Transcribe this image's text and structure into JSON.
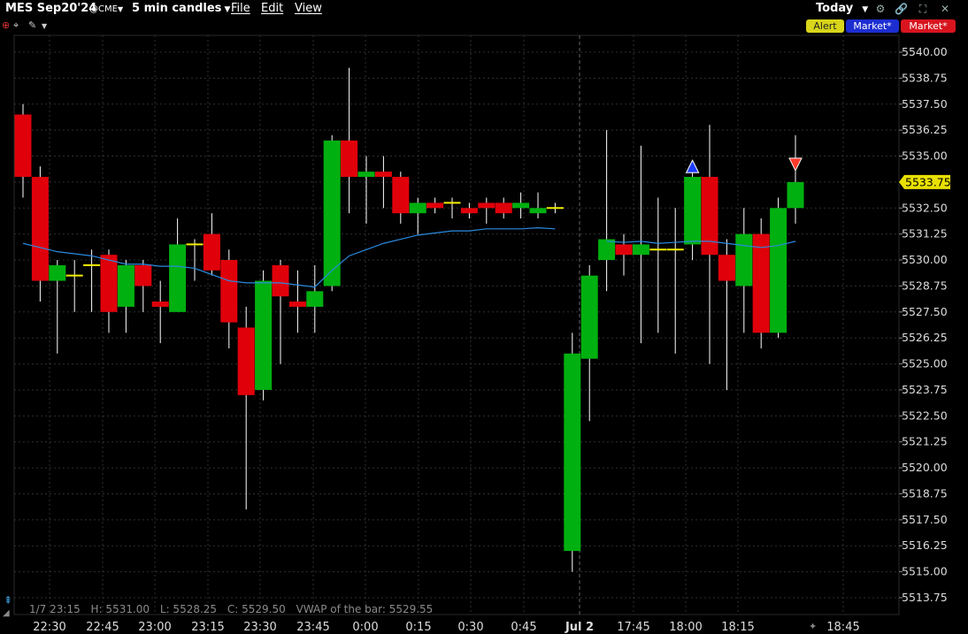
{
  "header": {
    "symbol": "MES Sep20'24",
    "exchange": "@CME",
    "timeframe": "5 min candles",
    "menu": [
      "File",
      "Edit",
      "View"
    ],
    "range": "Today",
    "icons": [
      "gear-icon",
      "link-icon",
      "expand-icon",
      "close-icon"
    ]
  },
  "order_buttons": {
    "alert": "Alert",
    "market_buy": "Market*",
    "market_sell": "Market*"
  },
  "colors": {
    "up": "#00b010",
    "down": "#e0000a",
    "vwap": "#2a8be0",
    "last_price_bg": "#e8e000"
  },
  "chart_data": {
    "type": "candlestick",
    "y_ticks": [
      "5540.00",
      "5538.75",
      "5537.50",
      "5536.25",
      "5535.00",
      "5533.75",
      "5532.50",
      "5531.25",
      "5530.00",
      "5528.75",
      "5527.50",
      "5526.25",
      "5525.00",
      "5523.75",
      "5522.50",
      "5521.25",
      "5520.00",
      "5518.75",
      "5517.50",
      "5516.25",
      "5515.00",
      "5513.75"
    ],
    "ylim": [
      5513.25,
      5540.25
    ],
    "x_ticks": [
      "22:30",
      "22:45",
      "23:00",
      "23:15",
      "23:30",
      "23:45",
      "0:00",
      "0:15",
      "0:30",
      "0:45",
      "Jul 2",
      "17:45",
      "18:00",
      "18:15",
      "18:45"
    ],
    "last_price": "5533.75",
    "bar_info": {
      "date_time": "1/7 23:15",
      "high": "H: 5531.00",
      "low": "L: 5528.25",
      "close": "C: 5529.50",
      "vwap": "VWAP of the bar: 5529.55"
    },
    "candles": [
      {
        "o": 5537.0,
        "h": 5537.5,
        "l": 5533.0,
        "c": 5534.0
      },
      {
        "o": 5534.0,
        "h": 5534.5,
        "l": 5528.0,
        "c": 5529.0
      },
      {
        "o": 5529.0,
        "h": 5530.0,
        "l": 5525.5,
        "c": 5529.75
      },
      {
        "o": 5529.25,
        "h": 5530.0,
        "l": 5527.5,
        "c": 5529.25
      },
      {
        "o": 5529.75,
        "h": 5530.5,
        "l": 5527.5,
        "c": 5529.75
      },
      {
        "o": 5530.25,
        "h": 5530.5,
        "l": 5526.5,
        "c": 5527.5
      },
      {
        "o": 5527.75,
        "h": 5530.0,
        "l": 5526.5,
        "c": 5529.75
      },
      {
        "o": 5529.75,
        "h": 5530.0,
        "l": 5527.5,
        "c": 5528.75
      },
      {
        "o": 5528.0,
        "h": 5529.0,
        "l": 5526.0,
        "c": 5527.75
      },
      {
        "o": 5527.5,
        "h": 5532.0,
        "l": 5527.5,
        "c": 5530.75
      },
      {
        "o": 5530.75,
        "h": 5531.0,
        "l": 5529.0,
        "c": 5530.75
      },
      {
        "o": 5531.25,
        "h": 5532.25,
        "l": 5529.25,
        "c": 5529.5
      },
      {
        "o": 5530.0,
        "h": 5530.5,
        "l": 5525.75,
        "c": 5527.0
      },
      {
        "o": 5526.75,
        "h": 5527.75,
        "l": 5518.0,
        "c": 5523.5
      },
      {
        "o": 5523.75,
        "h": 5529.5,
        "l": 5523.25,
        "c": 5529.0
      },
      {
        "o": 5529.75,
        "h": 5530.0,
        "l": 5525.0,
        "c": 5528.25
      },
      {
        "o": 5528.0,
        "h": 5529.5,
        "l": 5526.5,
        "c": 5527.75
      },
      {
        "o": 5527.75,
        "h": 5529.75,
        "l": 5526.5,
        "c": 5528.5
      },
      {
        "o": 5528.75,
        "h": 5536.0,
        "l": 5528.5,
        "c": 5535.75
      },
      {
        "o": 5535.75,
        "h": 5539.25,
        "l": 5532.25,
        "c": 5534.0
      },
      {
        "o": 5534.0,
        "h": 5535.0,
        "l": 5531.75,
        "c": 5534.25
      },
      {
        "o": 5534.25,
        "h": 5535.0,
        "l": 5532.5,
        "c": 5534.0
      },
      {
        "o": 5534.0,
        "h": 5534.25,
        "l": 5531.75,
        "c": 5532.25
      },
      {
        "o": 5532.25,
        "h": 5533.0,
        "l": 5531.25,
        "c": 5532.75
      },
      {
        "o": 5532.75,
        "h": 5533.0,
        "l": 5532.25,
        "c": 5532.5
      },
      {
        "o": 5532.75,
        "h": 5533.0,
        "l": 5532.0,
        "c": 5532.75
      },
      {
        "o": 5532.5,
        "h": 5532.75,
        "l": 5532.0,
        "c": 5532.25
      },
      {
        "o": 5532.75,
        "h": 5533.0,
        "l": 5531.75,
        "c": 5532.5
      },
      {
        "o": 5532.75,
        "h": 5533.0,
        "l": 5532.0,
        "c": 5532.25
      },
      {
        "o": 5532.5,
        "h": 5533.25,
        "l": 5532.0,
        "c": 5532.75
      },
      {
        "o": 5532.25,
        "h": 5533.25,
        "l": 5532.0,
        "c": 5532.5
      },
      {
        "o": 5532.5,
        "h": 5532.75,
        "l": 5532.25,
        "c": 5532.5
      },
      {
        "o": 5516.0,
        "h": 5526.5,
        "l": 5515.0,
        "c": 5525.5
      },
      {
        "o": 5525.25,
        "h": 5529.75,
        "l": 5522.25,
        "c": 5529.25
      },
      {
        "o": 5530.0,
        "h": 5536.25,
        "l": 5528.5,
        "c": 5531.0
      },
      {
        "o": 5530.75,
        "h": 5531.25,
        "l": 5529.25,
        "c": 5530.25
      },
      {
        "o": 5530.25,
        "h": 5535.5,
        "l": 5526.0,
        "c": 5530.75
      },
      {
        "o": 5530.5,
        "h": 5533.0,
        "l": 5526.5,
        "c": 5530.5
      },
      {
        "o": 5530.5,
        "h": 5532.5,
        "l": 5525.5,
        "c": 5530.5
      },
      {
        "o": 5530.75,
        "h": 5534.5,
        "l": 5530.0,
        "c": 5534.0
      },
      {
        "o": 5534.0,
        "h": 5536.5,
        "l": 5525.0,
        "c": 5530.25
      },
      {
        "o": 5530.25,
        "h": 5531.0,
        "l": 5523.75,
        "c": 5529.0
      },
      {
        "o": 5528.75,
        "h": 5532.5,
        "l": 5526.5,
        "c": 5531.25
      },
      {
        "o": 5531.25,
        "h": 5532.0,
        "l": 5525.75,
        "c": 5526.5
      },
      {
        "o": 5526.5,
        "h": 5533.0,
        "l": 5526.25,
        "c": 5532.5
      },
      {
        "o": 5532.5,
        "h": 5536.0,
        "l": 5531.75,
        "c": 5533.75
      }
    ],
    "vwap": [
      5530.8,
      5530.6,
      5530.4,
      5530.3,
      5530.2,
      5530.0,
      5529.8,
      5529.8,
      5529.7,
      5529.7,
      5529.6,
      5529.3,
      5529.0,
      5528.9,
      5528.9,
      5528.9,
      5528.8,
      5528.7,
      5529.5,
      5530.2,
      5530.5,
      5530.8,
      5531.0,
      5531.2,
      5531.3,
      5531.4,
      5531.4,
      5531.5,
      5531.5,
      5531.5,
      5531.55,
      5531.5,
      null,
      null,
      5530.9,
      5530.85,
      5530.9,
      5530.8,
      5530.85,
      5530.9,
      5530.9,
      5530.8,
      5530.7,
      5530.6,
      5530.7,
      5530.9
    ],
    "markers": [
      {
        "index": 39,
        "type": "buy",
        "price": 5534.5
      },
      {
        "index": 45,
        "type": "sell",
        "price": 5534.6
      }
    ]
  }
}
